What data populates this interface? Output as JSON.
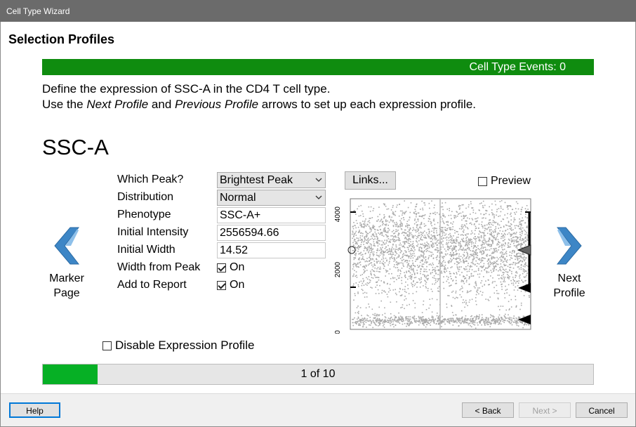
{
  "window": {
    "title": "Cell Type Wizard"
  },
  "page": {
    "section_title": "Selection Profiles",
    "events_label": "Cell Type Events: 0",
    "instruction_line1": "Define the expression of SSC-A in the CD4 T cell type.",
    "instruction_line2": {
      "a": "Use the ",
      "b": "Next Profile",
      "c": " and ",
      "d": "Previous Profile",
      "e": " arrows to set up each expression profile."
    },
    "parameter_title": "SSC-A"
  },
  "nav": {
    "marker_page_line1": "Marker",
    "marker_page_line2": "Page",
    "next_profile_line1": "Next",
    "next_profile_line2": "Profile",
    "arrow_color": "#3d86c6"
  },
  "form": {
    "which_peak_label": "Which Peak?",
    "which_peak_value": "Brightest Peak",
    "distribution_label": "Distribution",
    "distribution_value": "Normal",
    "phenotype_label": "Phenotype",
    "phenotype_value": "SSC-A+",
    "initial_intensity_label": "Initial Intensity",
    "initial_intensity_value": "2556594.66",
    "initial_width_label": "Initial Width",
    "initial_width_value": "14.52",
    "width_from_peak_label": "Width from Peak",
    "width_from_peak_value": "On",
    "width_from_peak_checked": true,
    "add_to_report_label": "Add to Report",
    "add_to_report_value": "On",
    "add_to_report_checked": true
  },
  "plot": {
    "links_label": "Links...",
    "preview_label": "Preview",
    "preview_checked": false,
    "y_ticks": [
      "0",
      "2000",
      "4000"
    ]
  },
  "disable_profile": {
    "label": "Disable Expression Profile",
    "checked": false
  },
  "progress": {
    "text": "1 of 10",
    "fraction": 0.1
  },
  "footer": {
    "help_label": "Help",
    "back_label": "< Back",
    "next_label": "Next >",
    "cancel_label": "Cancel"
  },
  "colors": {
    "events_bar": "#0f8c0f",
    "progress_fill": "#06b025"
  }
}
